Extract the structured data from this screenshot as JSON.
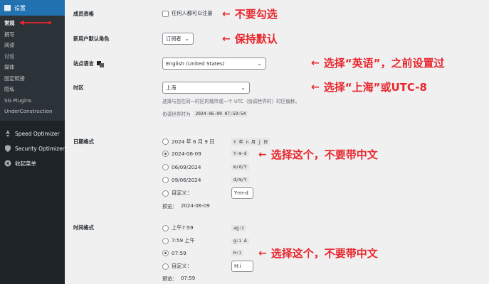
{
  "sidebar": {
    "header": "设置",
    "items": [
      {
        "label": "常规",
        "active": true
      },
      {
        "label": "撰写"
      },
      {
        "label": "阅读"
      },
      {
        "label": "讨论"
      },
      {
        "label": "媒体"
      },
      {
        "label": "固定链接"
      },
      {
        "label": "隐私"
      },
      {
        "label": "SG Plugins"
      },
      {
        "label": "UnderConstruction"
      }
    ],
    "plugins": [
      {
        "label": "Speed Optimizer"
      },
      {
        "label": "Security Optimizer"
      },
      {
        "label": "收起菜单"
      }
    ]
  },
  "settings": {
    "membership": {
      "label": "成员资格",
      "checkbox_label": "任何人都可以注册"
    },
    "default_role": {
      "label": "新用户默认角色",
      "value": "订阅者"
    },
    "site_language": {
      "label": "站点语言",
      "value": "English (United States)"
    },
    "timezone": {
      "label": "时区",
      "value": "上海",
      "help": "选择与您在同一时区的城市或一个 UTC（协调世界时）时区偏移。",
      "utc_label": "协调世界时为",
      "utc_value": "2024-06-09 07:59:54"
    },
    "date_format": {
      "label": "日期格式",
      "options": [
        {
          "text": "2024 年 6 月 9 日",
          "code": "Y 年 n 月 j 日",
          "selected": false
        },
        {
          "text": "2024-06-09",
          "code": "Y-m-d",
          "selected": true
        },
        {
          "text": "06/09/2024",
          "code": "m/d/Y",
          "selected": false
        },
        {
          "text": "09/06/2024",
          "code": "d/m/Y",
          "selected": false
        }
      ],
      "custom_label": "自定义：",
      "custom_value": "Y-m-d",
      "preview_label": "预览：",
      "preview_value": "2024-06-09"
    },
    "time_format": {
      "label": "时间格式",
      "options": [
        {
          "text": "上午7:59",
          "code": "ag:i",
          "selected": false
        },
        {
          "text": "7:59 上午",
          "code": "g:i A",
          "selected": false
        },
        {
          "text": "07:59",
          "code": "H:i",
          "selected": true
        }
      ],
      "custom_label": "自定义：",
      "custom_value": "H:i",
      "preview_label": "预览：",
      "preview_value": "07:59"
    }
  },
  "annotations": {
    "a1": "不要勾选",
    "a2": "保持默认",
    "a3": "选择“英语”，之前设置过",
    "a4": "选择“上海”或UTC-8",
    "a5": "选择这个，不要带中文",
    "a6": "选择这个，不要带中文",
    "color": "#e8262d"
  }
}
